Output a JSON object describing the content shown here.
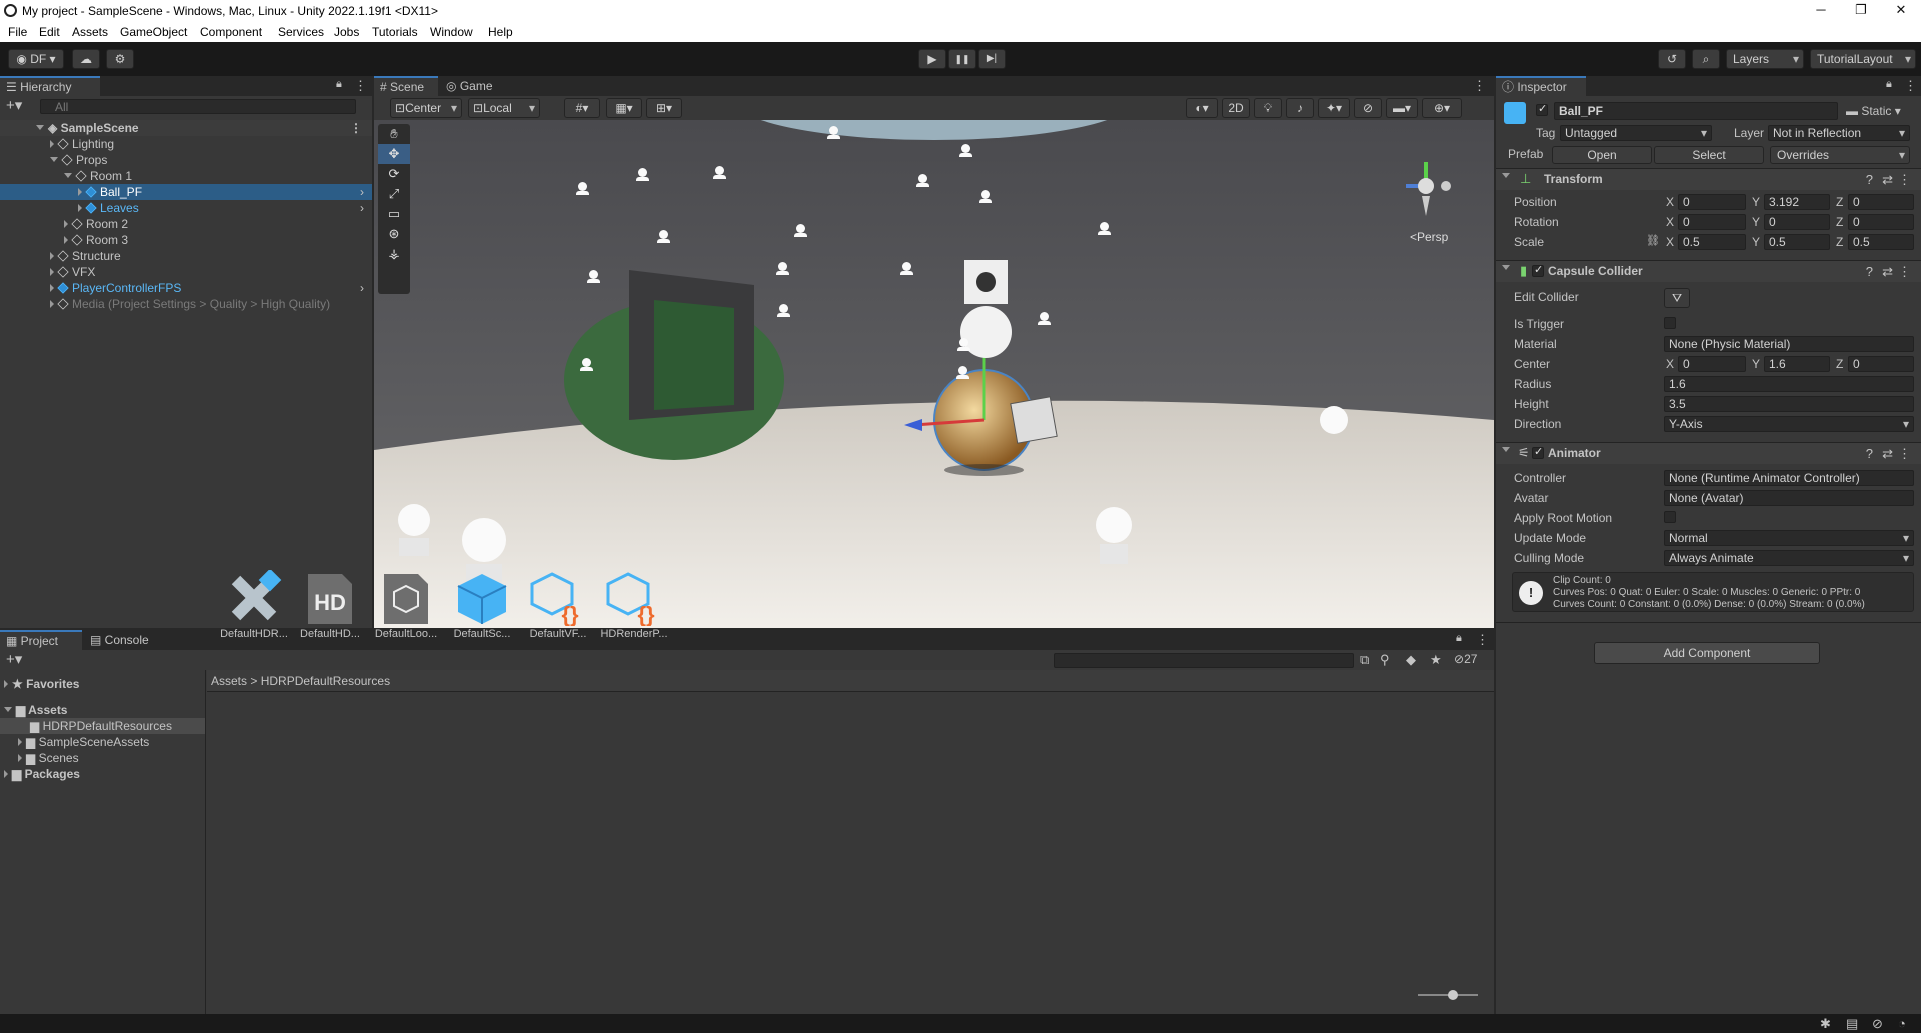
{
  "window": {
    "title": "My project - SampleScene - Windows, Mac, Linux - Unity 2022.1.19f1 <DX11>",
    "min": "─",
    "max": "❐",
    "close": "✕"
  },
  "menu": [
    "File",
    "Edit",
    "Assets",
    "GameObject",
    "Component",
    "Services",
    "Jobs",
    "Tutorials",
    "Window",
    "Help"
  ],
  "toolbar": {
    "account": "DF",
    "cloud_icon": "cloud-icon",
    "collab_icon": "collab-icon",
    "play": "▶",
    "pause": "❚❚",
    "step": "▶|",
    "history_icon": "history-icon",
    "search_icon": "search-icon",
    "layers": "Layers",
    "layout": "TutorialLayout"
  },
  "hierarchy": {
    "tab": "Hierarchy",
    "search_placeholder": "All",
    "scene": "SampleScene",
    "items": [
      {
        "label": "Lighting",
        "depth": 1,
        "expand": "collapsed"
      },
      {
        "label": "Props",
        "depth": 1,
        "expand": "expanded"
      },
      {
        "label": "Room 1",
        "depth": 2,
        "expand": "expanded"
      },
      {
        "label": "Ball_PF",
        "depth": 3,
        "expand": "collapsed",
        "selected": true,
        "prefab": true
      },
      {
        "label": "Leaves",
        "depth": 3,
        "expand": "collapsed",
        "prefab": true
      },
      {
        "label": "Room 2",
        "depth": 2,
        "expand": "collapsed"
      },
      {
        "label": "Room 3",
        "depth": 2,
        "expand": "collapsed"
      },
      {
        "label": "Structure",
        "depth": 1,
        "expand": "collapsed"
      },
      {
        "label": "VFX",
        "depth": 1,
        "expand": "collapsed"
      },
      {
        "label": "PlayerControllerFPS",
        "depth": 1,
        "expand": "collapsed",
        "prefab": true
      },
      {
        "label": "Media (Project Settings > Quality > High Quality)",
        "depth": 1,
        "expand": "collapsed",
        "disabled": true
      }
    ]
  },
  "scene": {
    "tabs": [
      "Scene",
      "Game"
    ],
    "pivot": "Center",
    "space": "Local",
    "mode2d": "2D",
    "persp": "<Persp"
  },
  "inspector": {
    "tab": "Inspector",
    "object": "Ball_PF",
    "static": "Static",
    "tag_label": "Tag",
    "tag": "Untagged",
    "layer_label": "Layer",
    "layer": "Not in Reflection",
    "prefab_label": "Prefab",
    "open": "Open",
    "select": "Select",
    "overrides": "Overrides",
    "transform": {
      "title": "Transform",
      "position": {
        "label": "Position",
        "x": "0",
        "y": "3.192",
        "z": "0"
      },
      "rotation": {
        "label": "Rotation",
        "x": "0",
        "y": "0",
        "z": "0"
      },
      "scale": {
        "label": "Scale",
        "x": "0.5",
        "y": "0.5",
        "z": "0.5"
      }
    },
    "capsule": {
      "title": "Capsule Collider",
      "edit": "Edit Collider",
      "is_trigger": "Is Trigger",
      "material_label": "Material",
      "material": "None (Physic Material)",
      "center_label": "Center",
      "cx": "0",
      "cy": "1.6",
      "cz": "0",
      "radius_label": "Radius",
      "radius": "1.6",
      "height_label": "Height",
      "height": "3.5",
      "direction_label": "Direction",
      "direction": "Y-Axis"
    },
    "animator": {
      "title": "Animator",
      "controller_label": "Controller",
      "controller": "None (Runtime Animator Controller)",
      "avatar_label": "Avatar",
      "avatar": "None (Avatar)",
      "root_motion": "Apply Root Motion",
      "update_label": "Update Mode",
      "update": "Normal",
      "culling_label": "Culling Mode",
      "culling": "Always Animate",
      "info1": "Clip Count: 0",
      "info2": "Curves Pos: 0 Quat: 0 Euler: 0 Scale: 0 Muscles: 0 Generic: 0 PPtr: 0",
      "info3": "Curves Count: 0 Constant: 0 (0.0%) Dense: 0 (0.0%) Stream: 0 (0.0%)"
    },
    "add_component": "Add Component"
  },
  "project": {
    "tabs": [
      "Project",
      "Console"
    ],
    "favorites": "Favorites",
    "assets": "Assets",
    "tree": [
      "HDRPDefaultResources",
      "SampleSceneAssets",
      "Scenes"
    ],
    "packages": "Packages",
    "breadcrumb": [
      "Assets",
      "HDRPDefaultResources"
    ],
    "count": "27",
    "files": [
      {
        "label": "DefaultHDR...",
        "icon": "diffusion-profile-icon"
      },
      {
        "label": "DefaultHD...",
        "icon": "hd-icon"
      },
      {
        "label": "DefaultLoo...",
        "icon": "look-dev-icon"
      },
      {
        "label": "DefaultSc...",
        "icon": "scene-asset-icon"
      },
      {
        "label": "DefaultVF...",
        "icon": "vfx-script-icon"
      },
      {
        "label": "HDRenderP...",
        "icon": "render-pipeline-icon"
      }
    ]
  },
  "colors": {
    "accent": "#3a79bb",
    "selection": "#2c5d87",
    "prefab": "#5ab8f7"
  }
}
